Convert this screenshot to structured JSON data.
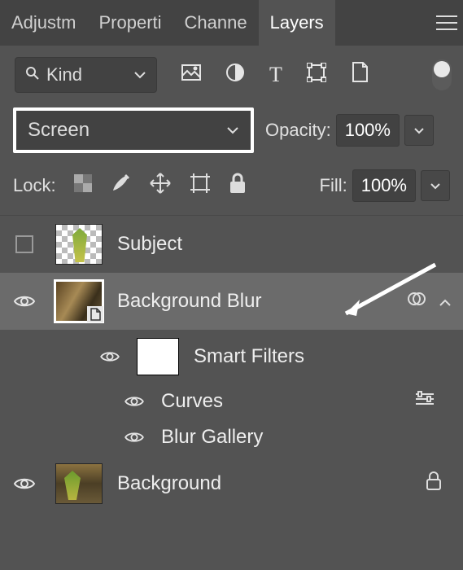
{
  "tabs": {
    "items": [
      "Adjustm",
      "Properti",
      "Channe",
      "Layers"
    ],
    "active_index": 3
  },
  "filter": {
    "kind_label": "Kind",
    "icons": [
      "pixel",
      "adjustment",
      "text",
      "shape",
      "smartobject"
    ]
  },
  "blend": {
    "mode": "Screen",
    "opacity_label": "Opacity:",
    "opacity_value": "100%"
  },
  "lock": {
    "label": "Lock:",
    "fill_label": "Fill:",
    "fill_value": "100%"
  },
  "layers": [
    {
      "visible": false,
      "has_checkbox": true,
      "thumb": "transparent",
      "name": "Subject"
    },
    {
      "visible": true,
      "has_checkbox": false,
      "thumb": "bg1",
      "name": "Background Blur",
      "selected": true,
      "smart": true,
      "expand": true,
      "fxlink": true
    },
    {
      "visible": true,
      "has_checkbox": false,
      "thumb": "bg2",
      "name": "Background",
      "locked": true
    }
  ],
  "smart_filters": {
    "label": "Smart Filters",
    "items": [
      {
        "name": "Curves",
        "icon": "sliders"
      },
      {
        "name": "Blur Gallery",
        "icon": ""
      }
    ]
  }
}
